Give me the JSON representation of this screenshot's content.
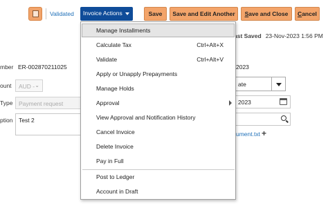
{
  "toolbar": {
    "validated_label": "Validated",
    "invoice_actions_label": "Invoice Actions",
    "save_label": "Save",
    "save_edit_label": "Save and Edit Another",
    "save_close_prefix": "S",
    "save_close_rest": "ave and Close",
    "cancel_prefix": "C",
    "cancel_rest": "ancel",
    "button_color": "#f3a46a",
    "actions_color": "#0f4c99"
  },
  "last_saved": {
    "label": "ast Saved",
    "value": "23-Nov-2023 1:56 PM"
  },
  "form": {
    "number_label": "mber",
    "number_value": "ER-002870211025",
    "amount_label": "ount",
    "currency_value": "AUD -",
    "type_label": "Type",
    "type_value": "Payment request",
    "description_label": "ption",
    "description_value": "Test 2",
    "invoice_date_partial": "2023",
    "terms_partial": "ate",
    "terms_date_partial": "2023",
    "attachment_partial": "ument.txt"
  },
  "menu": {
    "items": [
      {
        "label": "Manage Installments",
        "shortcut": ""
      },
      {
        "label": "Calculate Tax",
        "shortcut": "Ctrl+Alt+X"
      },
      {
        "label": "Validate",
        "shortcut": "Ctrl+Alt+V"
      },
      {
        "label": "Apply or Unapply Prepayments",
        "shortcut": ""
      },
      {
        "label": "Manage Holds",
        "shortcut": ""
      },
      {
        "label": "Approval",
        "shortcut": ""
      },
      {
        "label": "View Approval and Notification History",
        "shortcut": ""
      },
      {
        "label": "Cancel Invoice",
        "shortcut": ""
      },
      {
        "label": "Delete Invoice",
        "shortcut": ""
      },
      {
        "label": "Pay in Full",
        "shortcut": ""
      },
      {
        "label": "Post to Ledger",
        "shortcut": ""
      },
      {
        "label": "Account in Draft",
        "shortcut": ""
      }
    ],
    "highlighted": "Manage Installments"
  }
}
